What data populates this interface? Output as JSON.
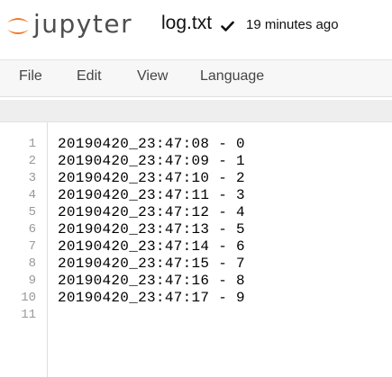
{
  "header": {
    "brand": "jupyter",
    "filename": "log.txt",
    "saved_status": "19 minutes ago",
    "logo_color": "#f37726",
    "logo_icon": "jupyter-logo-icon",
    "check_icon": "checkmark-icon"
  },
  "menubar": {
    "items": [
      {
        "label": "File"
      },
      {
        "label": "Edit"
      },
      {
        "label": "View"
      },
      {
        "label": "Language"
      }
    ]
  },
  "editor": {
    "lines": [
      {
        "num": "1",
        "text": "20190420_23:47:08 - 0"
      },
      {
        "num": "2",
        "text": "20190420_23:47:09 - 1"
      },
      {
        "num": "3",
        "text": "20190420_23:47:10 - 2"
      },
      {
        "num": "4",
        "text": "20190420_23:47:11 - 3"
      },
      {
        "num": "5",
        "text": "20190420_23:47:12 - 4"
      },
      {
        "num": "6",
        "text": "20190420_23:47:13 - 5"
      },
      {
        "num": "7",
        "text": "20190420_23:47:14 - 6"
      },
      {
        "num": "8",
        "text": "20190420_23:47:15 - 7"
      },
      {
        "num": "9",
        "text": "20190420_23:47:16 - 8"
      },
      {
        "num": "10",
        "text": "20190420_23:47:17 - 9"
      },
      {
        "num": "11",
        "text": ""
      }
    ]
  }
}
